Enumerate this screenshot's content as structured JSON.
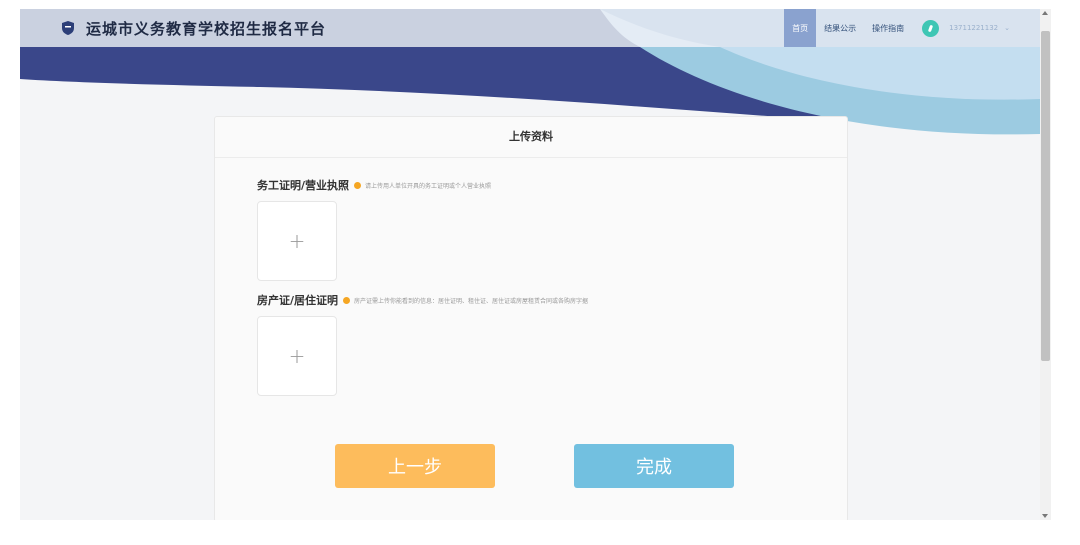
{
  "header": {
    "title": "运城市义务教育学校招生报名平台",
    "nav": [
      {
        "label": "首页",
        "active": true
      },
      {
        "label": "结果公示",
        "active": false
      },
      {
        "label": "操作指南",
        "active": false
      }
    ],
    "user_phone": "13711221132",
    "user_icon": "avatar-icon"
  },
  "card": {
    "title": "上传资料",
    "sections": [
      {
        "label": "务工证明/营业执照",
        "hint": "请上传用人单位开具的务工证明或个人营业执照"
      },
      {
        "label": "房产证/居住证明",
        "hint": "房产证需上传你能看到的信息：居住证明、租住证、居住证或房屋租赁合同或各购房字据"
      }
    ],
    "upload_symbol": "+"
  },
  "buttons": {
    "prev": "上一步",
    "done": "完成"
  },
  "colors": {
    "banner_dark": "#3a478a",
    "banner_light": "#9ccbe1",
    "prev_button": "#fdbc5c",
    "done_button": "#72c0e0",
    "hint_dot": "#f5a623"
  }
}
